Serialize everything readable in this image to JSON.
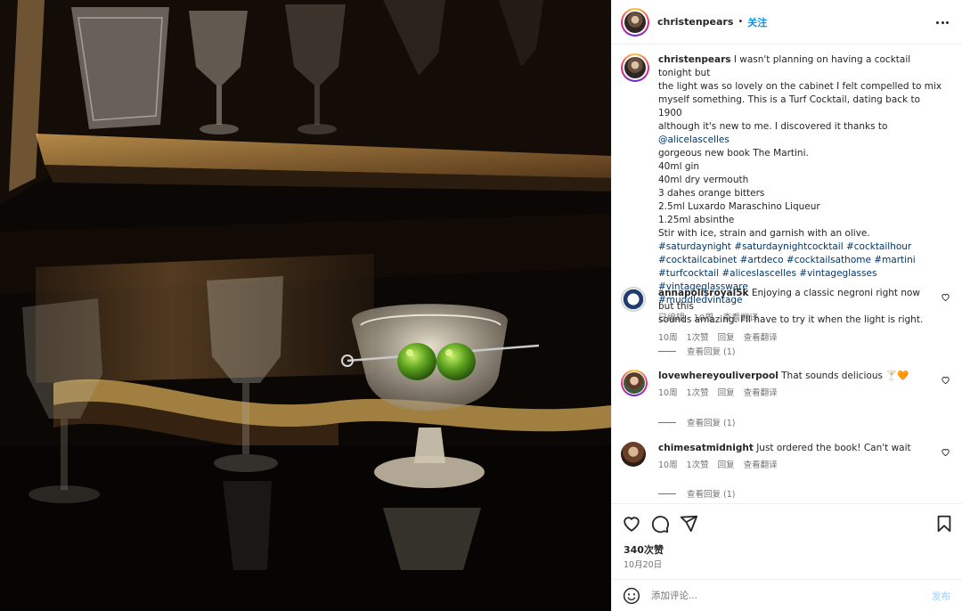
{
  "photo": {
    "description_icon": "cocktail-photo"
  },
  "header": {
    "username": "christenpears",
    "separator": "•",
    "follow_label": "关注",
    "more_icon": "more-horizontal-icon"
  },
  "caption": {
    "username": "christenpears",
    "text_lines": [
      "I wasn't planning on having a cocktail tonight but",
      "the light was so lovely on the cabinet I felt compelled to mix",
      "myself something. This is a Turf Cocktail, dating back to 1900",
      "although it's new to me. I discovered it thanks to "
    ],
    "mention": "@alicelascelles",
    "after_mention": "gorgeous new book The Martini.",
    "recipe": [
      "40ml gin",
      "40ml dry vermouth",
      "3 dahes orange bitters",
      "2.5ml Luxardo Maraschino Liqueur",
      "1.25ml absinthe",
      "Stir with ice, strain and garnish with an olive."
    ],
    "hashtag_lines": [
      "#saturdaynight #saturdaynightcocktail #cocktailhour",
      "#cocktailcabinet #artdeco #cocktailsathome #martini",
      "#turfcocktail #aliceslascelles #vintageglasses #vintageglassware",
      "#muddledvintage"
    ],
    "edited_label": "已编辑 · 10周",
    "translate_label": "查看翻译"
  },
  "comments": [
    {
      "username": "annapolisroyal5k",
      "text_lines": [
        "Enjoying a classic negroni right now but this",
        "sounds amazing. I'll have to try it when the light is right."
      ],
      "time": "10周",
      "likes": "1次赞",
      "reply": "回复",
      "translate": "查看翻译",
      "view_replies": "查看回复 (1)"
    },
    {
      "username": "lovewhereyouliverpool",
      "text_lines": [
        "That sounds delicious 🍸🧡"
      ],
      "time": "10周",
      "likes": "1次赞",
      "reply": "回复",
      "translate": "查看翻译",
      "view_replies": "查看回复 (1)"
    },
    {
      "username": "chimesatmidnight",
      "text_lines": [
        "Just ordered the book! Can't wait"
      ],
      "time": "10周",
      "likes": "1次赞",
      "reply": "回复",
      "translate": "查看翻译",
      "view_replies": "查看回复 (1)"
    }
  ],
  "actions": {
    "icons": [
      "heart-icon",
      "comment-icon",
      "share-icon",
      "bookmark-icon"
    ],
    "likes_count": "340次赞",
    "date": "10月20日"
  },
  "composer": {
    "placeholder": "添加评论...",
    "post_label": "发布",
    "emoji_icon": "emoji-icon"
  },
  "colors": {
    "link": "#00376b",
    "follow": "#0095f6",
    "muted": "#737373",
    "post_disabled": "#b2dffc"
  }
}
